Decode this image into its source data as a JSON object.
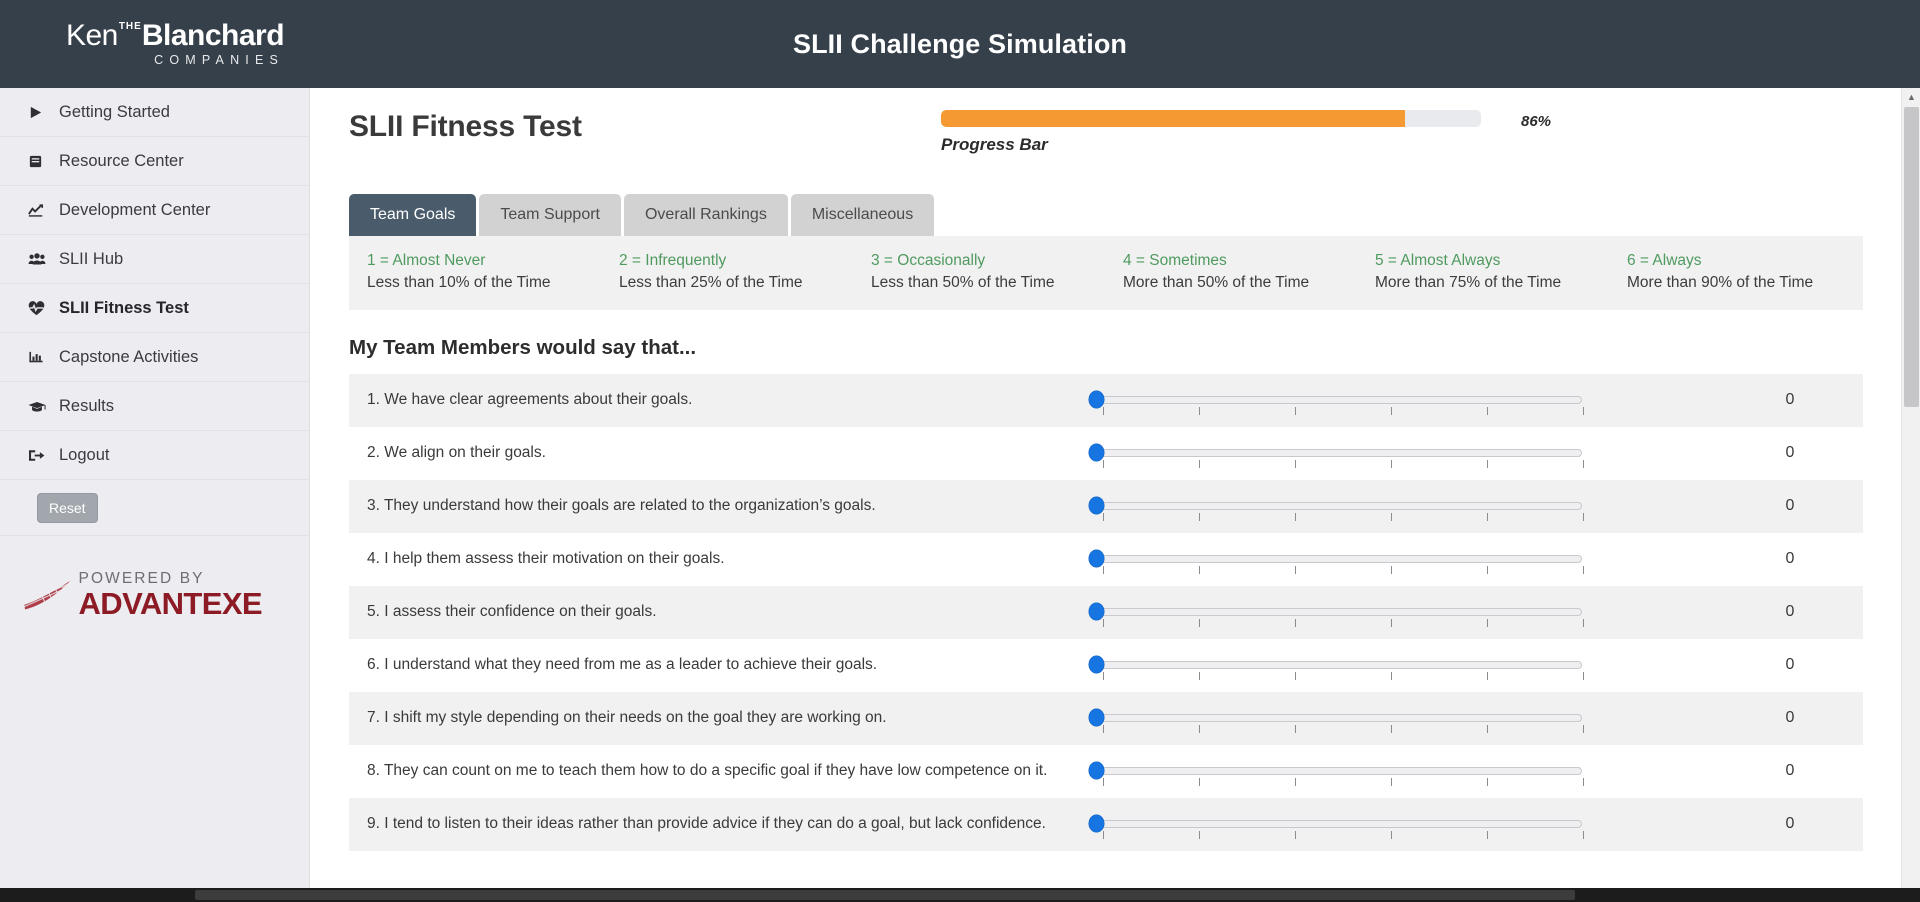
{
  "header": {
    "app_title": "SLII Challenge Simulation",
    "logo": {
      "the": "THE",
      "ken": "Ken",
      "blanchard": "Blanchard",
      "companies": "COMPANIES"
    }
  },
  "sidebar": {
    "items": [
      {
        "label": "Getting Started",
        "icon": "play-icon",
        "active": false
      },
      {
        "label": "Resource Center",
        "icon": "book-icon",
        "active": false
      },
      {
        "label": "Development Center",
        "icon": "chart-line-icon",
        "active": false
      },
      {
        "label": "SLII Hub",
        "icon": "users-icon",
        "active": false
      },
      {
        "label": "SLII Fitness Test",
        "icon": "heartbeat-icon",
        "active": true
      },
      {
        "label": "Capstone Activities",
        "icon": "bar-chart-icon",
        "active": false
      },
      {
        "label": "Results",
        "icon": "graduation-cap-icon",
        "active": false
      },
      {
        "label": "Logout",
        "icon": "sign-out-icon",
        "active": false
      }
    ],
    "reset_label": "Reset",
    "footer_logo": {
      "powered_by": "POWERED BY",
      "name": "ADVANTEXE"
    }
  },
  "main": {
    "page_title": "SLII Fitness Test",
    "progress": {
      "label": "Progress Bar",
      "percent_text": "86%",
      "percent_value": 86,
      "fill_color": "#f59a32",
      "track_color": "#e9eaee"
    },
    "tabs": [
      {
        "label": "Team Goals",
        "active": true
      },
      {
        "label": "Team Support",
        "active": false
      },
      {
        "label": "Overall Rankings",
        "active": false
      },
      {
        "label": "Miscellaneous",
        "active": false
      }
    ],
    "scale": [
      {
        "key": "1 = Almost Never",
        "sub": "Less than 10% of the Time"
      },
      {
        "key": "2 = Infrequently",
        "sub": "Less than 25% of the Time"
      },
      {
        "key": "3 = Occasionally",
        "sub": "Less than 50% of the Time"
      },
      {
        "key": "4 = Sometimes",
        "sub": "More than 50% of the Time"
      },
      {
        "key": "5 = Almost Always",
        "sub": "More than 75% of the Time"
      },
      {
        "key": "6 = Always",
        "sub": "More than 90% of the Time"
      }
    ],
    "section_heading": "My Team Members would say that...",
    "questions": [
      {
        "text": "1. We have clear agreements about their goals.",
        "value": "0"
      },
      {
        "text": "2. We align on their goals.",
        "value": "0"
      },
      {
        "text": "3. They understand how their goals are related to the organization’s goals.",
        "value": "0"
      },
      {
        "text": "4. I help them assess their motivation on their goals.",
        "value": "0"
      },
      {
        "text": "5. I assess their confidence on their goals.",
        "value": "0"
      },
      {
        "text": "6. I understand what they need from me as a leader to achieve their goals.",
        "value": "0"
      },
      {
        "text": "7. I shift my style depending on their needs on the goal they are working on.",
        "value": "0"
      },
      {
        "text": "8. They can count on me to teach them how to do a specific goal if they have low competence on it.",
        "value": "0"
      },
      {
        "text": "9. I tend to listen to their ideas rather than provide advice if they can do a goal, but lack confidence.",
        "value": "0"
      }
    ]
  }
}
